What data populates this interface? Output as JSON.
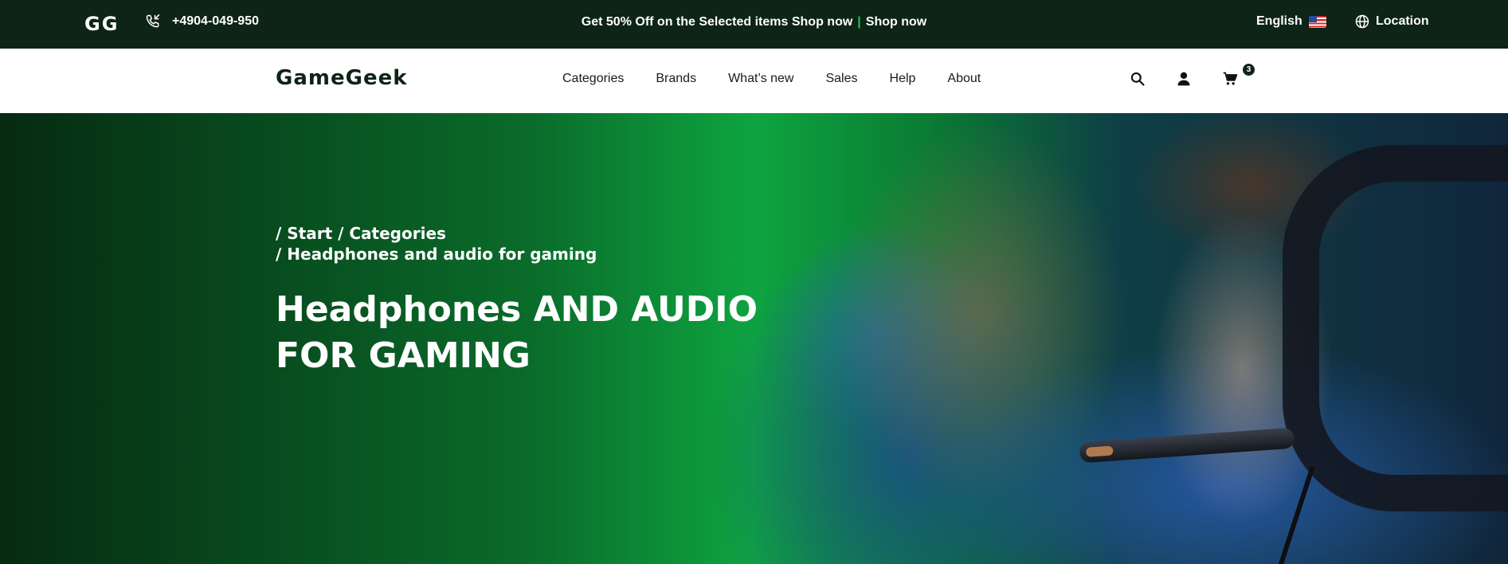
{
  "topbar": {
    "logo": "GG",
    "phone": "+4904-049-950",
    "promo_text": "Get 50% Off on the Selected items Shop now",
    "promo_separator": "|",
    "promo_link": "Shop now",
    "language": "English",
    "location": "Location",
    "accent_color": "#22c55e"
  },
  "navbar": {
    "brand": "GameGeek",
    "menu": [
      {
        "label": "Categories"
      },
      {
        "label": "Brands"
      },
      {
        "label": "What’s new"
      },
      {
        "label": "Sales"
      },
      {
        "label": "Help"
      },
      {
        "label": "About"
      }
    ],
    "icons": {
      "search": "search-icon",
      "account": "user-icon",
      "cart": "cart-icon"
    },
    "cart_count": "3"
  },
  "hero": {
    "breadcrumb_line1": "/ Start / Categories",
    "breadcrumb_line2": "/ Headphones and audio for gaming",
    "title_line1": "Headphones AND AUDIO",
    "title_line2": "FOR GAMING"
  }
}
